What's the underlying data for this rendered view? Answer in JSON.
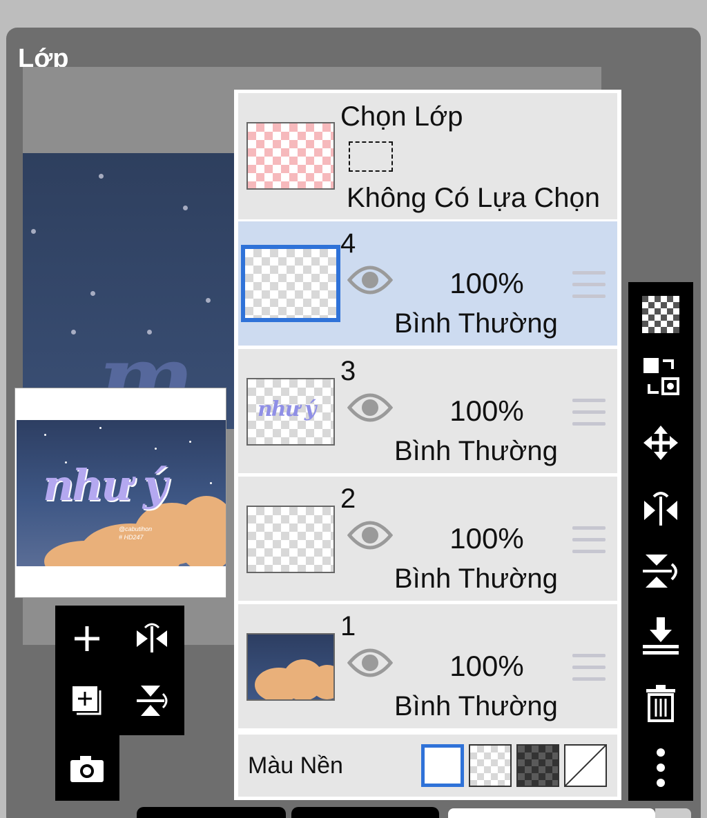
{
  "panel": {
    "title": "Lớp"
  },
  "selection": {
    "title": "Chọn Lớp",
    "status": "Không Có Lựa Chọn"
  },
  "layers": [
    {
      "number": "4",
      "opacity": "100%",
      "mode": "Bình Thường",
      "active": true
    },
    {
      "number": "3",
      "opacity": "100%",
      "mode": "Bình Thường",
      "active": false
    },
    {
      "number": "2",
      "opacity": "100%",
      "mode": "Bình Thường",
      "active": false
    },
    {
      "number": "1",
      "opacity": "100%",
      "mode": "Bình Thường",
      "active": false
    }
  ],
  "background": {
    "label": "Màu Nền",
    "options": [
      "white",
      "transparent",
      "dark-checker",
      "none"
    ],
    "selected": "white"
  },
  "preview": {
    "art_title": "như ý",
    "credit_line1": "@cabutihon",
    "credit_line2": "# HD247"
  },
  "layer3_thumb_text": "như ý",
  "left_tools": [
    "add-layer-icon",
    "flip-horizontal-icon",
    "duplicate-layer-icon",
    "flip-vertical-icon",
    "camera-icon"
  ],
  "right_tools": [
    "transparency-icon",
    "swap-layers-icon",
    "move-icon",
    "flip-horizontal-icon",
    "flip-vertical-icon",
    "merge-down-icon",
    "trash-icon",
    "more-icon"
  ],
  "colors": {
    "accent": "#2f72d8",
    "active_row": "#cddbf0",
    "row": "#e6e6e6",
    "panel": "#6e6e6e"
  }
}
